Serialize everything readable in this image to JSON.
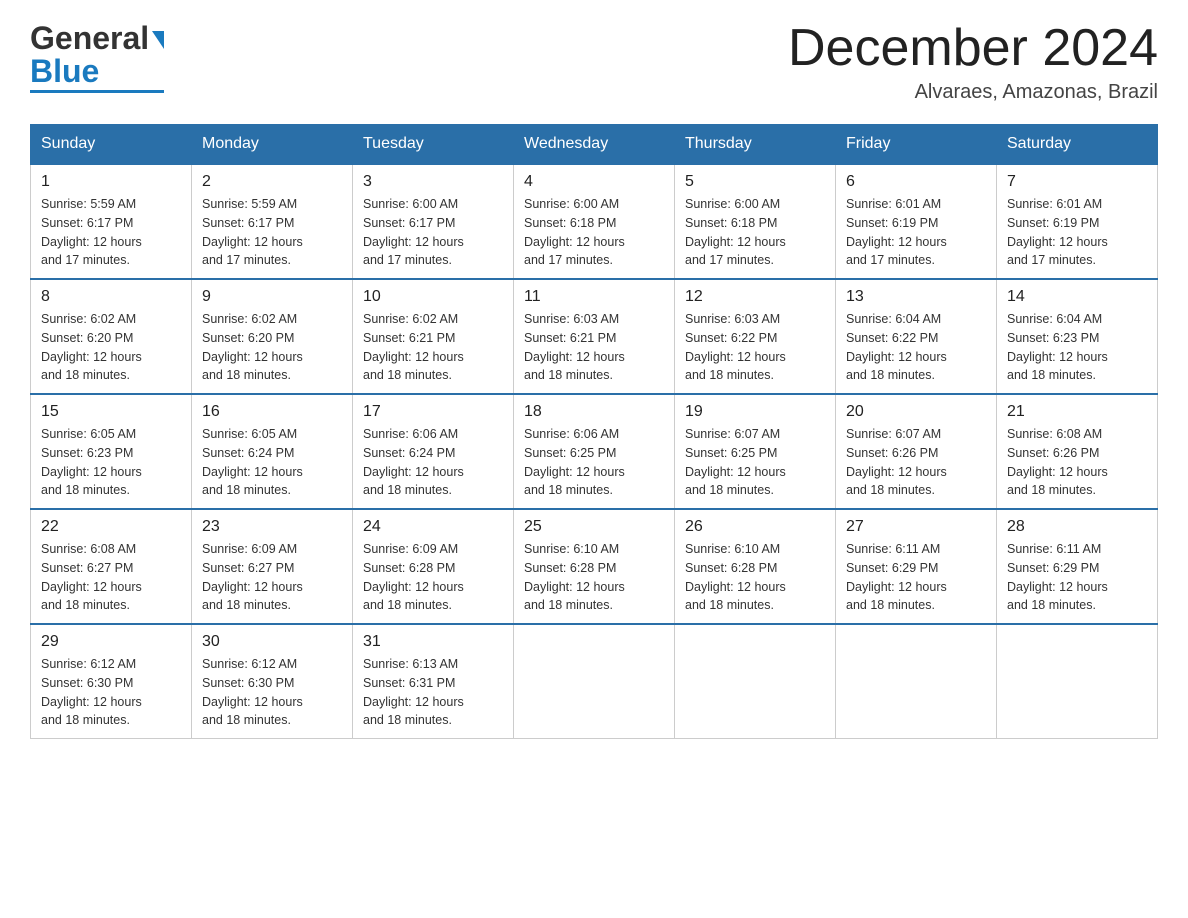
{
  "logo": {
    "general_text": "General",
    "blue_text": "Blue"
  },
  "header": {
    "month_title": "December 2024",
    "location": "Alvaraes, Amazonas, Brazil"
  },
  "weekdays": [
    "Sunday",
    "Monday",
    "Tuesday",
    "Wednesday",
    "Thursday",
    "Friday",
    "Saturday"
  ],
  "weeks": [
    {
      "days": [
        {
          "number": "1",
          "sunrise": "Sunrise: 5:59 AM",
          "sunset": "Sunset: 6:17 PM",
          "daylight": "Daylight: 12 hours and 17 minutes."
        },
        {
          "number": "2",
          "sunrise": "Sunrise: 5:59 AM",
          "sunset": "Sunset: 6:17 PM",
          "daylight": "Daylight: 12 hours and 17 minutes."
        },
        {
          "number": "3",
          "sunrise": "Sunrise: 6:00 AM",
          "sunset": "Sunset: 6:17 PM",
          "daylight": "Daylight: 12 hours and 17 minutes."
        },
        {
          "number": "4",
          "sunrise": "Sunrise: 6:00 AM",
          "sunset": "Sunset: 6:18 PM",
          "daylight": "Daylight: 12 hours and 17 minutes."
        },
        {
          "number": "5",
          "sunrise": "Sunrise: 6:00 AM",
          "sunset": "Sunset: 6:18 PM",
          "daylight": "Daylight: 12 hours and 17 minutes."
        },
        {
          "number": "6",
          "sunrise": "Sunrise: 6:01 AM",
          "sunset": "Sunset: 6:19 PM",
          "daylight": "Daylight: 12 hours and 17 minutes."
        },
        {
          "number": "7",
          "sunrise": "Sunrise: 6:01 AM",
          "sunset": "Sunset: 6:19 PM",
          "daylight": "Daylight: 12 hours and 17 minutes."
        }
      ]
    },
    {
      "days": [
        {
          "number": "8",
          "sunrise": "Sunrise: 6:02 AM",
          "sunset": "Sunset: 6:20 PM",
          "daylight": "Daylight: 12 hours and 18 minutes."
        },
        {
          "number": "9",
          "sunrise": "Sunrise: 6:02 AM",
          "sunset": "Sunset: 6:20 PM",
          "daylight": "Daylight: 12 hours and 18 minutes."
        },
        {
          "number": "10",
          "sunrise": "Sunrise: 6:02 AM",
          "sunset": "Sunset: 6:21 PM",
          "daylight": "Daylight: 12 hours and 18 minutes."
        },
        {
          "number": "11",
          "sunrise": "Sunrise: 6:03 AM",
          "sunset": "Sunset: 6:21 PM",
          "daylight": "Daylight: 12 hours and 18 minutes."
        },
        {
          "number": "12",
          "sunrise": "Sunrise: 6:03 AM",
          "sunset": "Sunset: 6:22 PM",
          "daylight": "Daylight: 12 hours and 18 minutes."
        },
        {
          "number": "13",
          "sunrise": "Sunrise: 6:04 AM",
          "sunset": "Sunset: 6:22 PM",
          "daylight": "Daylight: 12 hours and 18 minutes."
        },
        {
          "number": "14",
          "sunrise": "Sunrise: 6:04 AM",
          "sunset": "Sunset: 6:23 PM",
          "daylight": "Daylight: 12 hours and 18 minutes."
        }
      ]
    },
    {
      "days": [
        {
          "number": "15",
          "sunrise": "Sunrise: 6:05 AM",
          "sunset": "Sunset: 6:23 PM",
          "daylight": "Daylight: 12 hours and 18 minutes."
        },
        {
          "number": "16",
          "sunrise": "Sunrise: 6:05 AM",
          "sunset": "Sunset: 6:24 PM",
          "daylight": "Daylight: 12 hours and 18 minutes."
        },
        {
          "number": "17",
          "sunrise": "Sunrise: 6:06 AM",
          "sunset": "Sunset: 6:24 PM",
          "daylight": "Daylight: 12 hours and 18 minutes."
        },
        {
          "number": "18",
          "sunrise": "Sunrise: 6:06 AM",
          "sunset": "Sunset: 6:25 PM",
          "daylight": "Daylight: 12 hours and 18 minutes."
        },
        {
          "number": "19",
          "sunrise": "Sunrise: 6:07 AM",
          "sunset": "Sunset: 6:25 PM",
          "daylight": "Daylight: 12 hours and 18 minutes."
        },
        {
          "number": "20",
          "sunrise": "Sunrise: 6:07 AM",
          "sunset": "Sunset: 6:26 PM",
          "daylight": "Daylight: 12 hours and 18 minutes."
        },
        {
          "number": "21",
          "sunrise": "Sunrise: 6:08 AM",
          "sunset": "Sunset: 6:26 PM",
          "daylight": "Daylight: 12 hours and 18 minutes."
        }
      ]
    },
    {
      "days": [
        {
          "number": "22",
          "sunrise": "Sunrise: 6:08 AM",
          "sunset": "Sunset: 6:27 PM",
          "daylight": "Daylight: 12 hours and 18 minutes."
        },
        {
          "number": "23",
          "sunrise": "Sunrise: 6:09 AM",
          "sunset": "Sunset: 6:27 PM",
          "daylight": "Daylight: 12 hours and 18 minutes."
        },
        {
          "number": "24",
          "sunrise": "Sunrise: 6:09 AM",
          "sunset": "Sunset: 6:28 PM",
          "daylight": "Daylight: 12 hours and 18 minutes."
        },
        {
          "number": "25",
          "sunrise": "Sunrise: 6:10 AM",
          "sunset": "Sunset: 6:28 PM",
          "daylight": "Daylight: 12 hours and 18 minutes."
        },
        {
          "number": "26",
          "sunrise": "Sunrise: 6:10 AM",
          "sunset": "Sunset: 6:28 PM",
          "daylight": "Daylight: 12 hours and 18 minutes."
        },
        {
          "number": "27",
          "sunrise": "Sunrise: 6:11 AM",
          "sunset": "Sunset: 6:29 PM",
          "daylight": "Daylight: 12 hours and 18 minutes."
        },
        {
          "number": "28",
          "sunrise": "Sunrise: 6:11 AM",
          "sunset": "Sunset: 6:29 PM",
          "daylight": "Daylight: 12 hours and 18 minutes."
        }
      ]
    },
    {
      "days": [
        {
          "number": "29",
          "sunrise": "Sunrise: 6:12 AM",
          "sunset": "Sunset: 6:30 PM",
          "daylight": "Daylight: 12 hours and 18 minutes."
        },
        {
          "number": "30",
          "sunrise": "Sunrise: 6:12 AM",
          "sunset": "Sunset: 6:30 PM",
          "daylight": "Daylight: 12 hours and 18 minutes."
        },
        {
          "number": "31",
          "sunrise": "Sunrise: 6:13 AM",
          "sunset": "Sunset: 6:31 PM",
          "daylight": "Daylight: 12 hours and 18 minutes."
        },
        {
          "number": "",
          "empty": true
        },
        {
          "number": "",
          "empty": true
        },
        {
          "number": "",
          "empty": true
        },
        {
          "number": "",
          "empty": true
        }
      ]
    }
  ]
}
